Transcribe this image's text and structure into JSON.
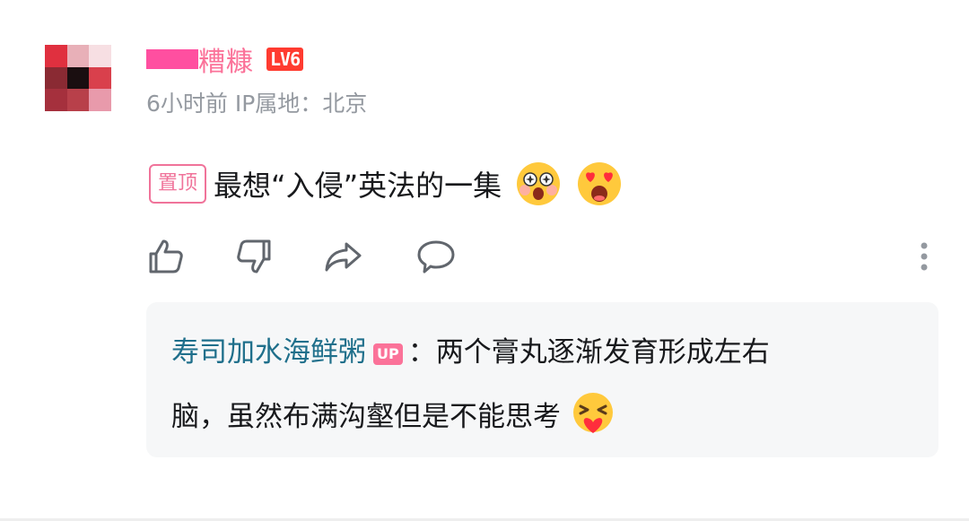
{
  "comment": {
    "username": "糟糠",
    "level": "LV6",
    "meta": "6小时前  IP属地：北京",
    "pinned_label": "置顶",
    "text": "最想“入侵”英法的一集"
  },
  "reply": {
    "author": "寿司加水海鲜粥",
    "badge": "UP",
    "line1": "：两个膏丸逐渐发育形成左右",
    "line2": "脑，虽然布满沟壑但是不能思考"
  },
  "icons": [
    "thumbs-up-icon",
    "thumbs-down-icon",
    "share-icon",
    "reply-icon",
    "more-icon"
  ],
  "colors": {
    "accent": "#fb7299",
    "reply_author": "#1f6f8b",
    "level": "#ff3b30",
    "meta": "#9499a0",
    "reply_bg": "#f6f7f8"
  }
}
